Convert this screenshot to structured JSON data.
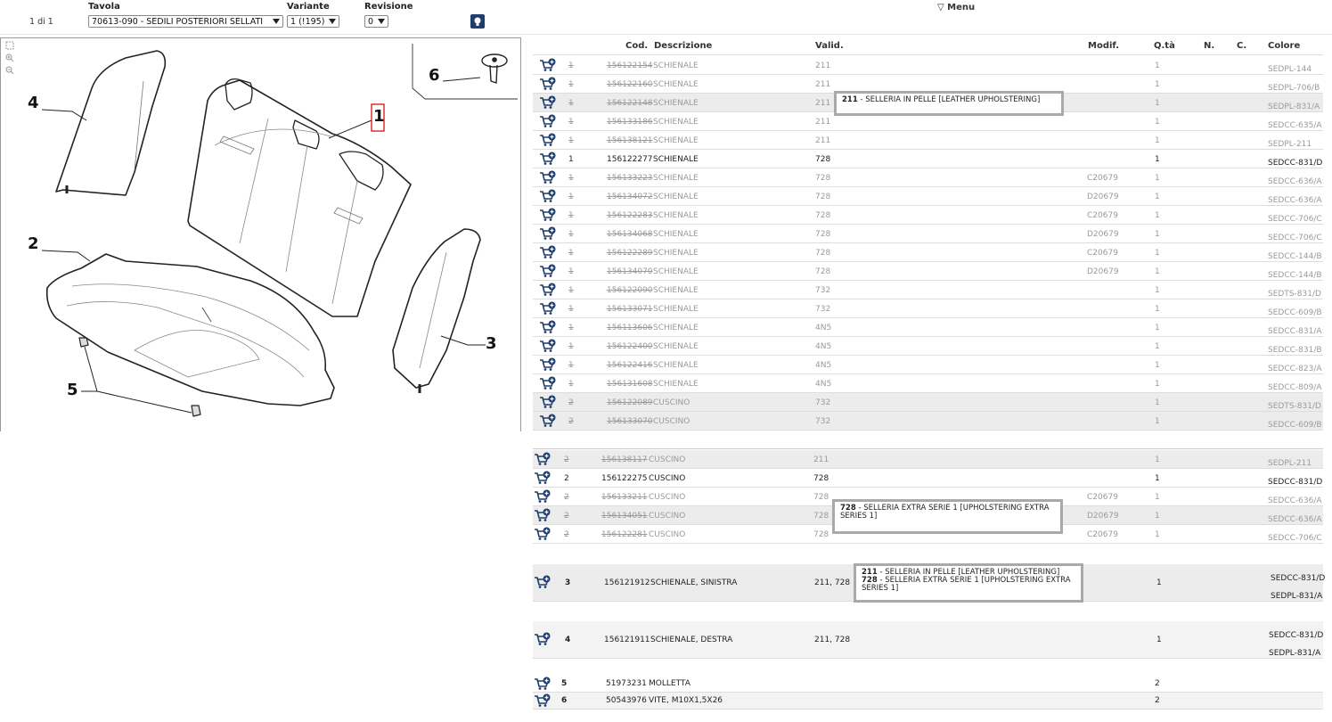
{
  "toolbar": {
    "page_counter": "1 di 1",
    "tavola_label": "Tavola",
    "tavola_value": "70613-090 - SEDILI POSTERIORI SELLATI",
    "variante_label": "Variante",
    "variante_value": "1 (!195)",
    "revisione_label": "Revisione",
    "revisione_value": "0",
    "menu_label": "▽ Menu"
  },
  "drawing": {
    "callouts": [
      "1",
      "2",
      "3",
      "4",
      "5",
      "6"
    ]
  },
  "table": {
    "headers": {
      "cod": "Cod.",
      "descrizione": "Descrizione",
      "valid": "Valid.",
      "modif": "Modif.",
      "qta": "Q.tà",
      "n": "N.",
      "c": "C.",
      "colore": "Colore"
    },
    "rows_top": [
      {
        "n": "1",
        "cod": "156122154",
        "desc": "SCHIENALE",
        "valid": "211",
        "modif": "",
        "qta": "1",
        "colore": "SEDPL-144",
        "active": false
      },
      {
        "n": "1",
        "cod": "156122160",
        "desc": "SCHIENALE",
        "valid": "211",
        "modif": "",
        "qta": "1",
        "colore": "SEDPL-706/B",
        "active": false
      },
      {
        "n": "1",
        "cod": "156122148",
        "desc": "SCHIENALE",
        "valid": "211",
        "modif": "",
        "qta": "1",
        "colore": "SEDPL-831/A",
        "active": false
      },
      {
        "n": "1",
        "cod": "156133186",
        "desc": "SCHIENALE",
        "valid": "211",
        "modif": "",
        "qta": "1",
        "colore": "SEDCC-635/A",
        "active": false
      },
      {
        "n": "1",
        "cod": "156138121",
        "desc": "SCHIENALE",
        "valid": "211",
        "modif": "",
        "qta": "1",
        "colore": "SEDPL-211",
        "active": false
      },
      {
        "n": "1",
        "cod": "156122277",
        "desc": "SCHIENALE",
        "valid": "728",
        "modif": "",
        "qta": "1",
        "colore": "SEDCC-831/D",
        "active": true
      },
      {
        "n": "1",
        "cod": "156133223",
        "desc": "SCHIENALE",
        "valid": "728",
        "modif": "C20679",
        "qta": "1",
        "colore": "SEDCC-636/A",
        "active": false
      },
      {
        "n": "1",
        "cod": "156134072",
        "desc": "SCHIENALE",
        "valid": "728",
        "modif": "D20679",
        "qta": "1",
        "colore": "SEDCC-636/A",
        "active": false
      },
      {
        "n": "1",
        "cod": "156122283",
        "desc": "SCHIENALE",
        "valid": "728",
        "modif": "C20679",
        "qta": "1",
        "colore": "SEDCC-706/C",
        "active": false
      },
      {
        "n": "1",
        "cod": "156134068",
        "desc": "SCHIENALE",
        "valid": "728",
        "modif": "D20679",
        "qta": "1",
        "colore": "SEDCC-706/C",
        "active": false
      },
      {
        "n": "1",
        "cod": "156122289",
        "desc": "SCHIENALE",
        "valid": "728",
        "modif": "C20679",
        "qta": "1",
        "colore": "SEDCC-144/B",
        "active": false
      },
      {
        "n": "1",
        "cod": "156134070",
        "desc": "SCHIENALE",
        "valid": "728",
        "modif": "D20679",
        "qta": "1",
        "colore": "SEDCC-144/B",
        "active": false
      },
      {
        "n": "1",
        "cod": "156122090",
        "desc": "SCHIENALE",
        "valid": "732",
        "modif": "",
        "qta": "1",
        "colore": "SEDTS-831/D",
        "active": false
      },
      {
        "n": "1",
        "cod": "156133071",
        "desc": "SCHIENALE",
        "valid": "732",
        "modif": "",
        "qta": "1",
        "colore": "SEDCC-609/B",
        "active": false
      },
      {
        "n": "1",
        "cod": "156113606",
        "desc": "SCHIENALE",
        "valid": "4N5",
        "modif": "",
        "qta": "1",
        "colore": "SEDCC-831/A",
        "active": false
      },
      {
        "n": "1",
        "cod": "156122400",
        "desc": "SCHIENALE",
        "valid": "4N5",
        "modif": "",
        "qta": "1",
        "colore": "SEDCC-831/B",
        "active": false
      },
      {
        "n": "1",
        "cod": "156122416",
        "desc": "SCHIENALE",
        "valid": "4N5",
        "modif": "",
        "qta": "1",
        "colore": "SEDCC-823/A",
        "active": false
      },
      {
        "n": "1",
        "cod": "156131608",
        "desc": "SCHIENALE",
        "valid": "4N5",
        "modif": "",
        "qta": "1",
        "colore": "SEDCC-809/A",
        "active": false
      },
      {
        "n": "2",
        "cod": "156122089",
        "desc": "CUSCINO",
        "valid": "732",
        "modif": "",
        "qta": "1",
        "colore": "SEDTS-831/D",
        "active": false
      },
      {
        "n": "2",
        "cod": "156133070",
        "desc": "CUSCINO",
        "valid": "732",
        "modif": "",
        "qta": "1",
        "colore": "SEDCC-609/B",
        "active": false
      }
    ],
    "rows_mid": [
      {
        "n": "2",
        "cod": "156138117",
        "desc": "CUSCINO",
        "valid": "211",
        "modif": "",
        "qta": "1",
        "colore": "SEDPL-211",
        "active": false
      },
      {
        "n": "2",
        "cod": "156122275",
        "desc": "CUSCINO",
        "valid": "728",
        "modif": "",
        "qta": "1",
        "colore": "SEDCC-831/D",
        "active": true
      },
      {
        "n": "2",
        "cod": "156133211",
        "desc": "CUSCINO",
        "valid": "728",
        "modif": "C20679",
        "qta": "1",
        "colore": "SEDCC-636/A",
        "active": false
      },
      {
        "n": "2",
        "cod": "156134051",
        "desc": "CUSCINO",
        "valid": "728",
        "modif": "D20679",
        "qta": "1",
        "colore": "SEDCC-636/A",
        "active": false
      },
      {
        "n": "2",
        "cod": "156122281",
        "desc": "CUSCINO",
        "valid": "728",
        "modif": "C20679",
        "qta": "1",
        "colore": "SEDCC-706/C",
        "active": false
      }
    ],
    "row3": {
      "n": "3",
      "cod": "156121912",
      "desc": "SCHIENALE, SINISTRA",
      "valid": "211, 728",
      "qta": "1",
      "colore1": "SEDCC-831/D",
      "colore2": "SEDPL-831/A"
    },
    "row4": {
      "n": "4",
      "cod": "156121911",
      "desc": "SCHIENALE, DESTRA",
      "valid": "211, 728",
      "qta": "1",
      "colore1": "SEDCC-831/D",
      "colore2": "SEDPL-831/A"
    },
    "row5": {
      "n": "5",
      "cod": "51973231",
      "desc": "MOLLETTA",
      "qta": "2"
    },
    "row6": {
      "n": "6",
      "cod": "50543976",
      "desc": "VITE, M10X1,5X26",
      "qta": "2"
    }
  },
  "tooltips": {
    "t1_code": "211",
    "t1_text": " - SELLERIA IN PELLE [LEATHER UPHOLSTERING]",
    "t2_code": "728",
    "t2_text": " - SELLERIA EXTRA SERIE 1 [UPHOLSTERING EXTRA SERIES 1]",
    "t3_code1": "211",
    "t3_text1": " - SELLERIA IN PELLE [LEATHER UPHOLSTERING]",
    "t3_code2": "728",
    "t3_text2": " - SELLERIA EXTRA SERIE 1 [UPHOLSTERING EXTRA SERIES 1]"
  }
}
